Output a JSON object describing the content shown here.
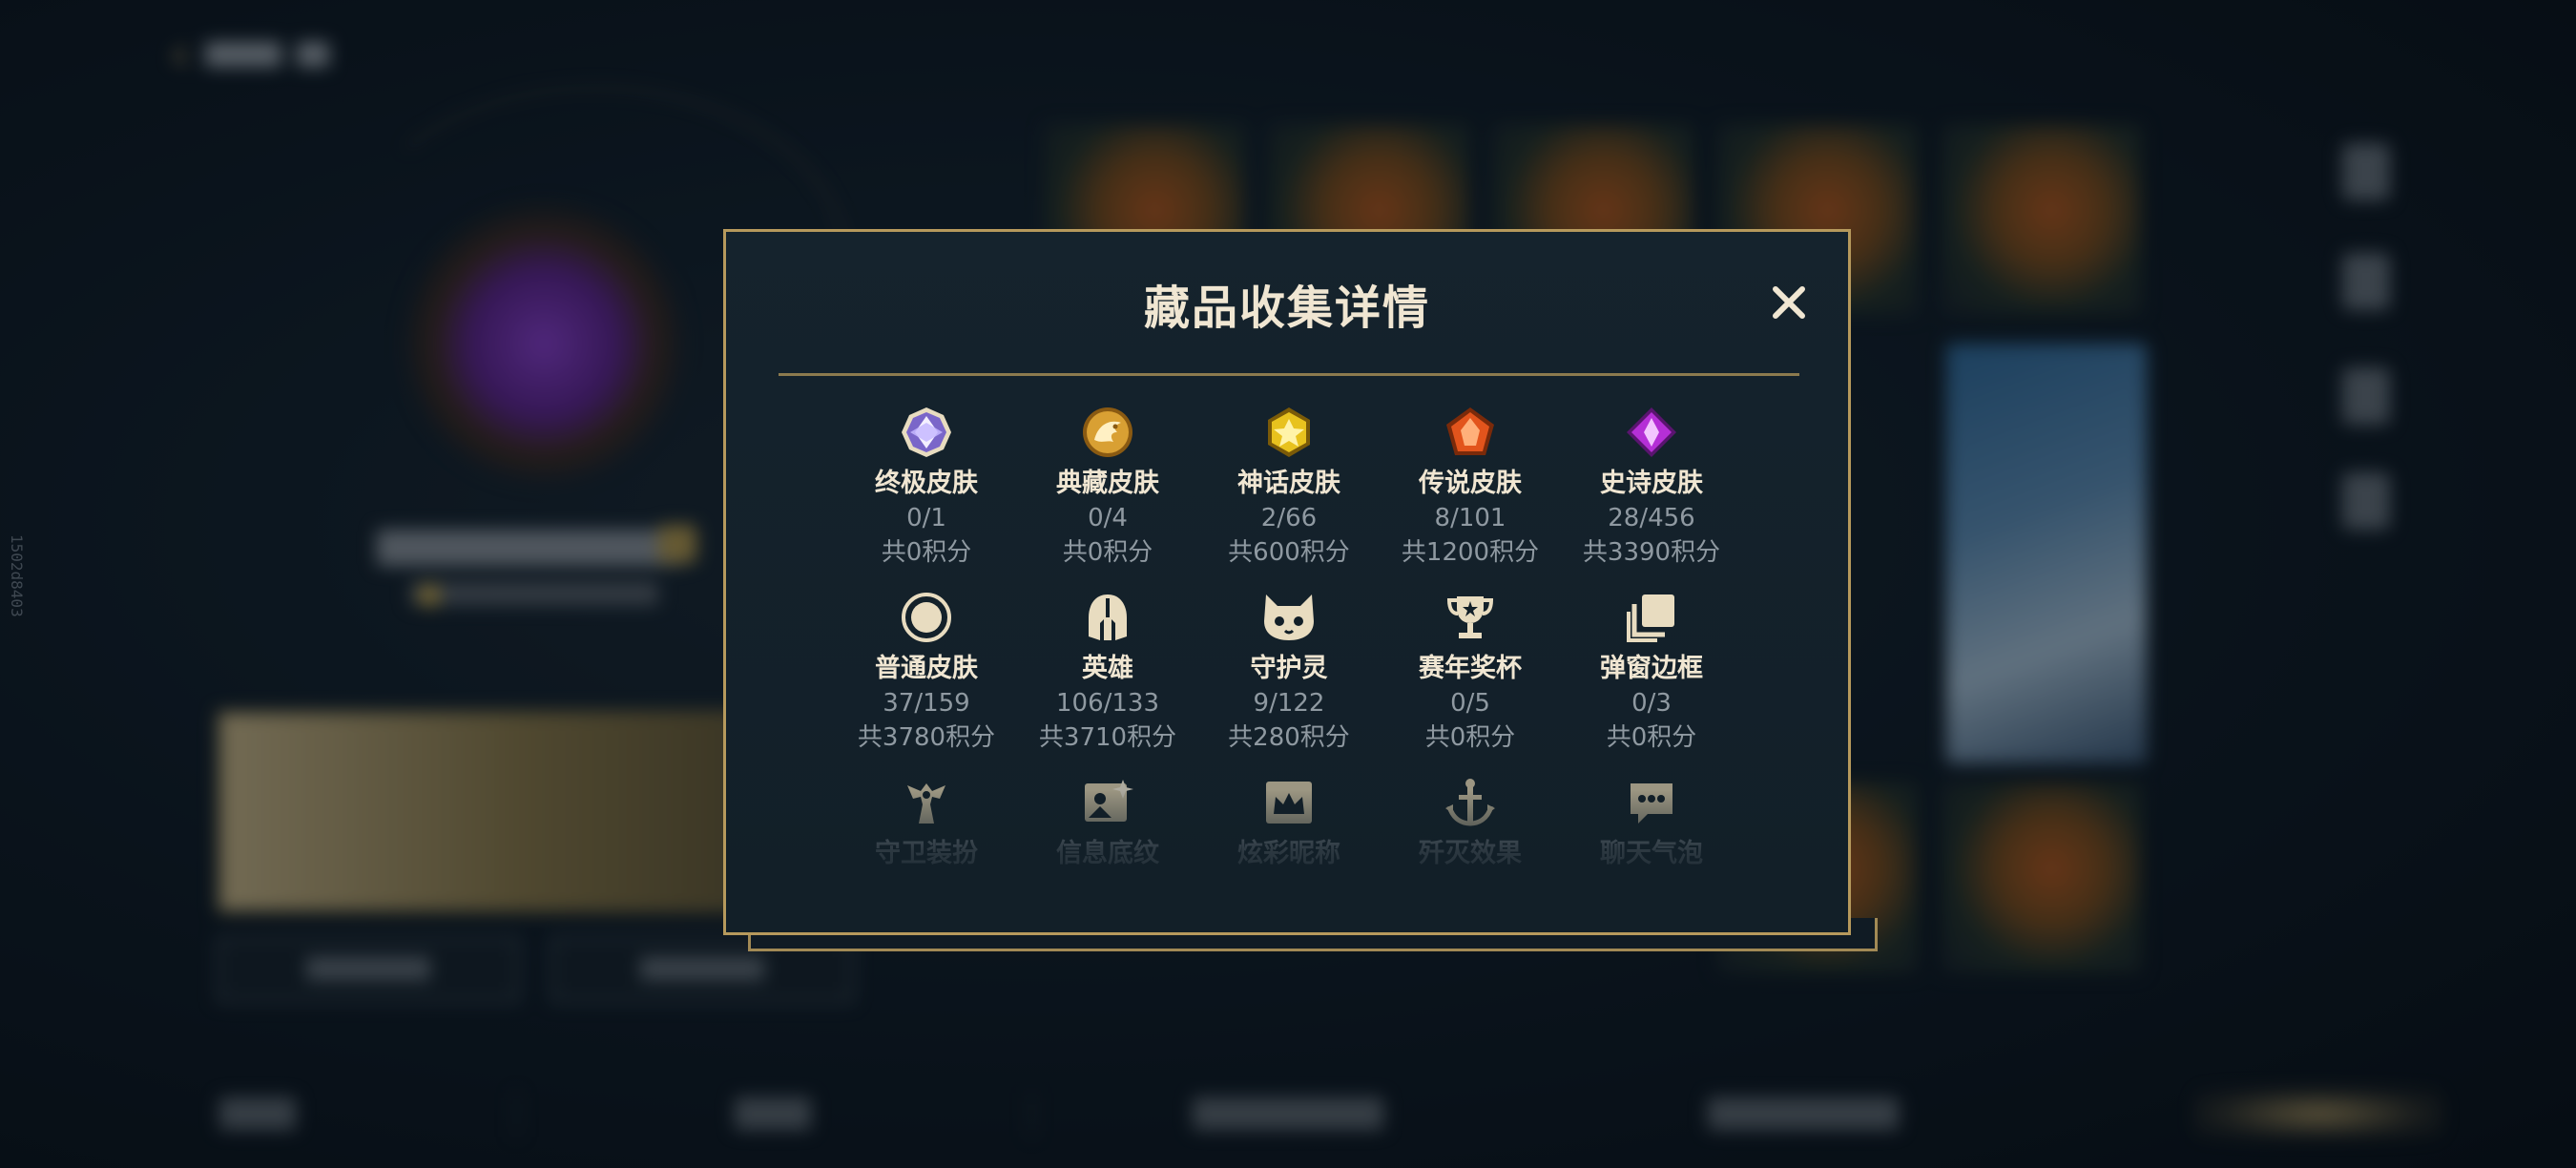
{
  "dialog": {
    "title": "藏品收集详情",
    "close_icon": "close-x-icon"
  },
  "items": [
    {
      "name": "终极皮肤",
      "count": "0/1",
      "points": "共0积分",
      "icon": "ultimate-skin-icon",
      "color": "#b9a9ff"
    },
    {
      "name": "典藏皮肤",
      "count": "0/4",
      "points": "共0积分",
      "icon": "prestige-skin-icon",
      "color": "#d9a033"
    },
    {
      "name": "神话皮肤",
      "count": "2/66",
      "points": "共600积分",
      "icon": "mythic-skin-icon",
      "color": "#e8c21e"
    },
    {
      "name": "传说皮肤",
      "count": "8/101",
      "points": "共1200积分",
      "icon": "legendary-skin-icon",
      "color": "#e2541c"
    },
    {
      "name": "史诗皮肤",
      "count": "28/456",
      "points": "共3390积分",
      "icon": "epic-skin-icon",
      "color": "#b52fd6"
    },
    {
      "name": "普通皮肤",
      "count": "37/159",
      "points": "共3780积分",
      "icon": "common-skin-icon",
      "color": "#e8dcc0"
    },
    {
      "name": "英雄",
      "count": "106/133",
      "points": "共3710积分",
      "icon": "champion-helmet-icon",
      "color": "#e8dcc0"
    },
    {
      "name": "守护灵",
      "count": "9/122",
      "points": "共280积分",
      "icon": "guardian-pet-icon",
      "color": "#e8dcc0"
    },
    {
      "name": "赛年奖杯",
      "count": "0/5",
      "points": "共0积分",
      "icon": "season-trophy-icon",
      "color": "#e8dcc0"
    },
    {
      "name": "弹窗边框",
      "count": "0/3",
      "points": "共0积分",
      "icon": "popup-frame-icon",
      "color": "#e8dcc0"
    },
    {
      "name": "守卫装扮",
      "icon": "ward-skin-icon",
      "color": "#d6c9a8"
    },
    {
      "name": "信息底纹",
      "icon": "profile-background-icon",
      "color": "#d6c9a8"
    },
    {
      "name": "炫彩昵称",
      "icon": "colorful-nickname-icon",
      "color": "#d6c9a8"
    },
    {
      "name": "歼灭效果",
      "icon": "elimination-effect-icon",
      "color": "#d6c9a8"
    },
    {
      "name": "聊天气泡",
      "icon": "chat-bubble-icon",
      "color": "#d6c9a8"
    }
  ],
  "side_id": "1502d8403",
  "colors": {
    "gold": "#c8aa6e",
    "title": "#f0e6d2",
    "muted": "#8f99a1",
    "panel": "#121f28"
  }
}
